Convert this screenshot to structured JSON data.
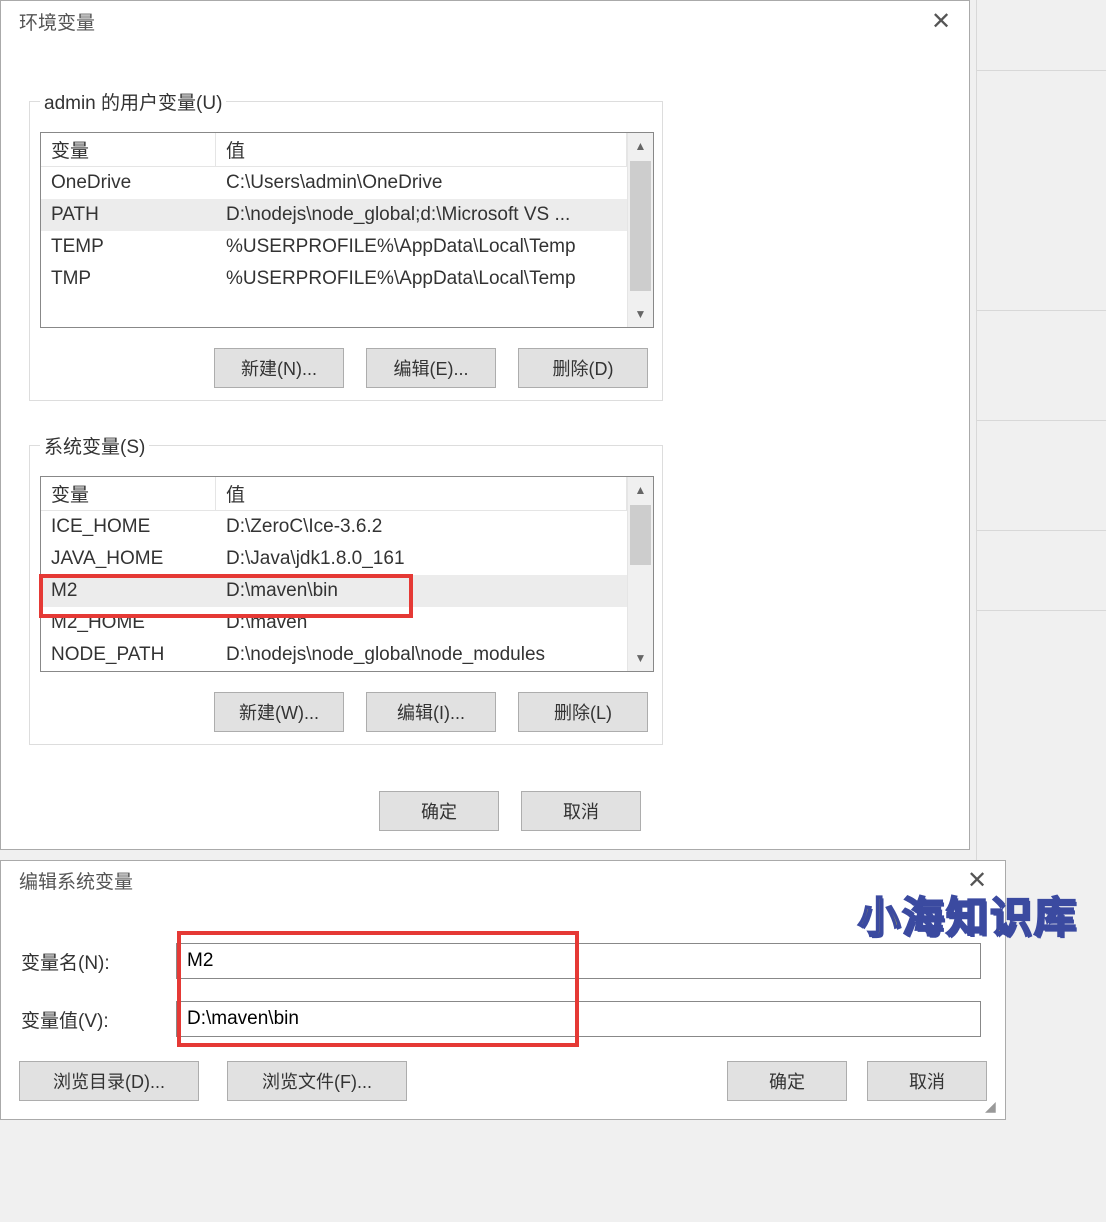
{
  "env_window": {
    "title": "环境变量",
    "user_group_label": "admin 的用户变量(U)",
    "sys_group_label": "系统变量(S)",
    "columns": {
      "name": "变量",
      "value": "值"
    },
    "user_vars": [
      {
        "name": "OneDrive",
        "value": "C:\\Users\\admin\\OneDrive",
        "selected": false
      },
      {
        "name": "PATH",
        "value": "D:\\nodejs\\node_global;d:\\Microsoft VS ...",
        "selected": true
      },
      {
        "name": "TEMP",
        "value": "%USERPROFILE%\\AppData\\Local\\Temp",
        "selected": false
      },
      {
        "name": "TMP",
        "value": "%USERPROFILE%\\AppData\\Local\\Temp",
        "selected": false
      }
    ],
    "sys_vars": [
      {
        "name": "ICE_HOME",
        "value": "D:\\ZeroC\\Ice-3.6.2",
        "selected": false
      },
      {
        "name": "JAVA_HOME",
        "value": "D:\\Java\\jdk1.8.0_161",
        "selected": false
      },
      {
        "name": "M2",
        "value": "D:\\maven\\bin",
        "selected": true
      },
      {
        "name": "M2_HOME",
        "value": "D:\\maven",
        "selected": false
      },
      {
        "name": "NODE_PATH",
        "value": "D:\\nodejs\\node_global\\node_modules",
        "selected": false
      }
    ],
    "buttons": {
      "user_new": "新建(N)...",
      "user_edit": "编辑(E)...",
      "user_delete": "删除(D)",
      "sys_new": "新建(W)...",
      "sys_edit": "编辑(I)...",
      "sys_delete": "删除(L)",
      "ok": "确定",
      "cancel": "取消"
    }
  },
  "edit_dialog": {
    "title": "编辑系统变量",
    "name_label": "变量名(N):",
    "value_label": "变量值(V):",
    "name_value": "M2",
    "value_value": "D:\\maven\\bin",
    "buttons": {
      "browse_dir": "浏览目录(D)...",
      "browse_file": "浏览文件(F)...",
      "ok": "确定",
      "cancel": "取消"
    }
  },
  "watermark": "小海知识库"
}
